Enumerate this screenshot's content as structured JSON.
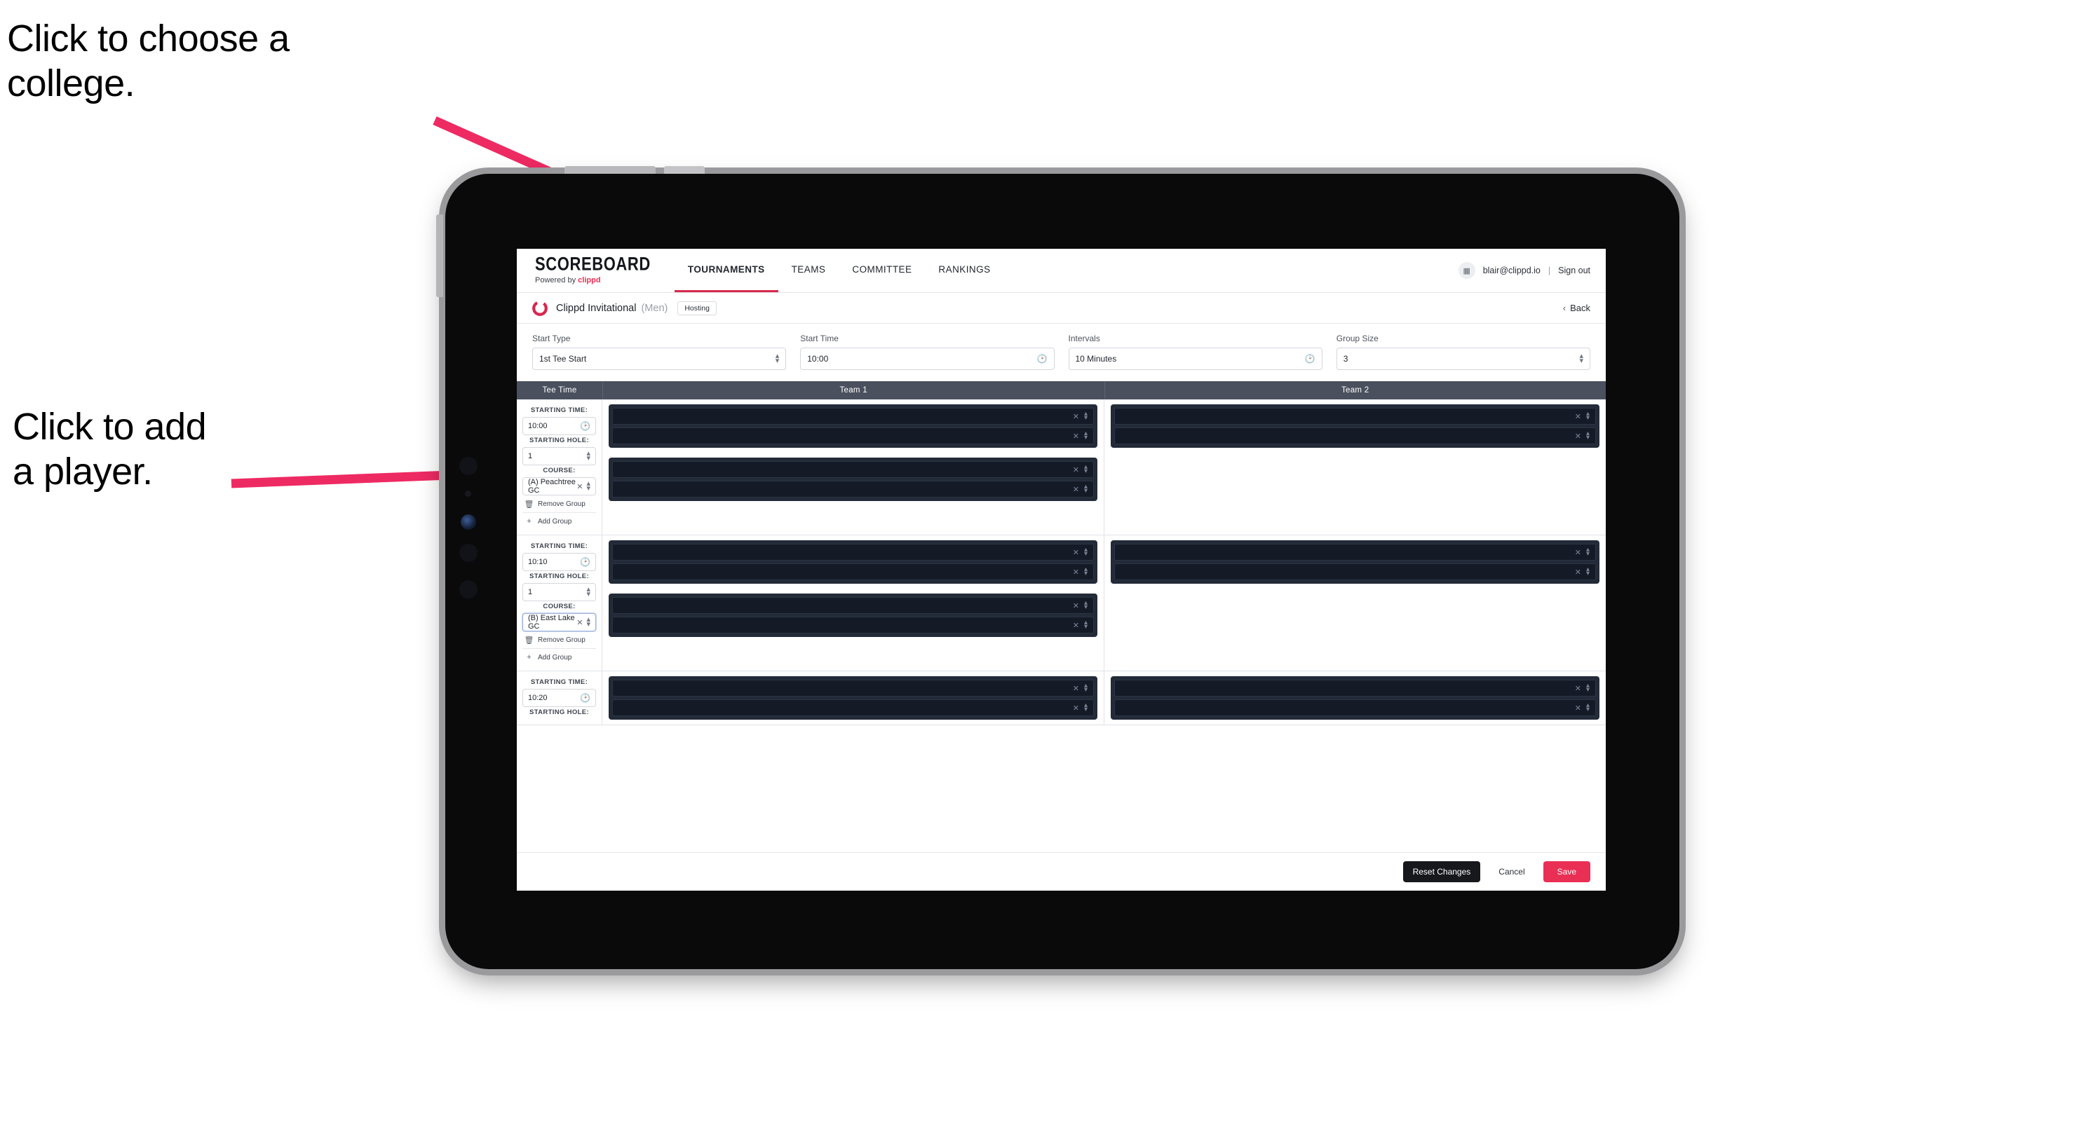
{
  "annotations": {
    "college": "Click to choose a\ncollege.",
    "player": "Click to add\na player."
  },
  "colors": {
    "accent": "#ea2f55",
    "arrow": "#ee2a63",
    "nav_active": "#d72a4d",
    "table_header_bg": "#4a505e",
    "slot_bg": "#141a26",
    "group_bg": "#232a38"
  },
  "navbar": {
    "brand_title": "SCOREBOARD",
    "brand_sub_prefix": "Powered by ",
    "brand_sub_accent": "clippd",
    "items": [
      {
        "label": "TOURNAMENTS",
        "active": true
      },
      {
        "label": "TEAMS",
        "active": false
      },
      {
        "label": "COMMITTEE",
        "active": false
      },
      {
        "label": "RANKINGS",
        "active": false
      }
    ],
    "avatar_icon": "user-badge-icon",
    "email": "blair@clippd.io",
    "separator": "|",
    "sign_out": "Sign out"
  },
  "titlebar": {
    "logo_icon": "clippd-c-logo-icon",
    "tournament_name": "Clippd Invitational",
    "gender": "(Men)",
    "badge": "Hosting",
    "back_chevron": "‹",
    "back_label": "Back"
  },
  "controls": [
    {
      "label": "Start Type",
      "value": "1st Tee Start",
      "icon": "stepper-icon"
    },
    {
      "label": "Start Time",
      "value": "10:00",
      "icon": "clock-icon"
    },
    {
      "label": "Intervals",
      "value": "10 Minutes",
      "icon": "clock-icon"
    },
    {
      "label": "Group Size",
      "value": "3",
      "icon": "stepper-icon"
    }
  ],
  "table": {
    "headers": {
      "tee_time": "Tee Time",
      "team1": "Team 1",
      "team2": "Team 2"
    },
    "labels": {
      "starting_time": "STARTING TIME:",
      "starting_hole": "STARTING HOLE:",
      "course": "COURSE:",
      "remove_group": "Remove Group",
      "add_group": "Add Group"
    },
    "rows": [
      {
        "starting_time": "10:00",
        "starting_hole": "1",
        "course": "(A) Peachtree GC",
        "course_focused": false,
        "team1_groups": [
          2,
          2
        ],
        "team2_groups": [
          2
        ]
      },
      {
        "starting_time": "10:10",
        "starting_hole": "1",
        "course": "(B) East Lake GC",
        "course_focused": true,
        "team1_groups": [
          2,
          2
        ],
        "team2_groups": [
          2
        ]
      },
      {
        "starting_time": "10:20",
        "starting_hole": "",
        "course": "",
        "course_focused": false,
        "team1_groups": [
          2
        ],
        "team2_groups": [
          2
        ]
      }
    ]
  },
  "footer": {
    "reset": "Reset Changes",
    "cancel": "Cancel",
    "save": "Save"
  }
}
